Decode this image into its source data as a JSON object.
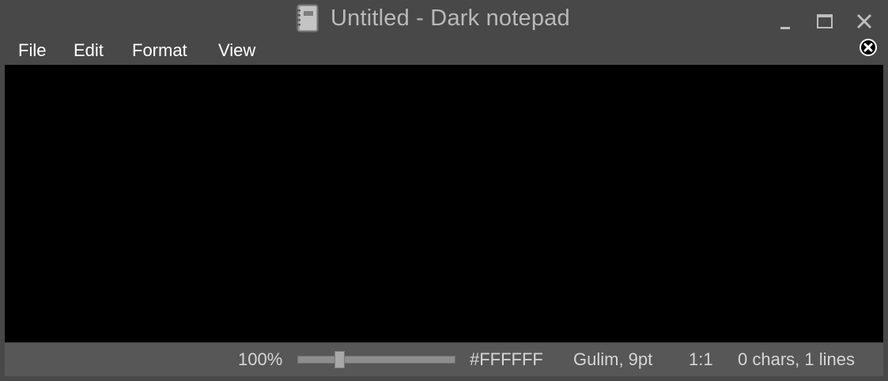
{
  "window": {
    "title": "Untitled - Dark notepad",
    "icon": "notebook-icon",
    "controls": [
      "minimize-icon",
      "maximize-icon",
      "close-icon"
    ]
  },
  "menu": {
    "file": "File",
    "edit": "Edit",
    "format": "Format",
    "view": "View",
    "close_tab_icon": "close-circle-icon"
  },
  "editor": {
    "content": "",
    "background": "#000000",
    "text_color": "#FFFFFF"
  },
  "status": {
    "zoom": "100%",
    "zoom_level_fraction": 0.25,
    "color": "#FFFFFF",
    "font": "Gulim, 9pt",
    "position": "1:1",
    "counts": "0 chars, 1 lines"
  },
  "colors": {
    "chrome": "#484848",
    "statusbar": "#575757",
    "title_text": "#B9B9B9",
    "menu_text": "#FFFFFF"
  }
}
